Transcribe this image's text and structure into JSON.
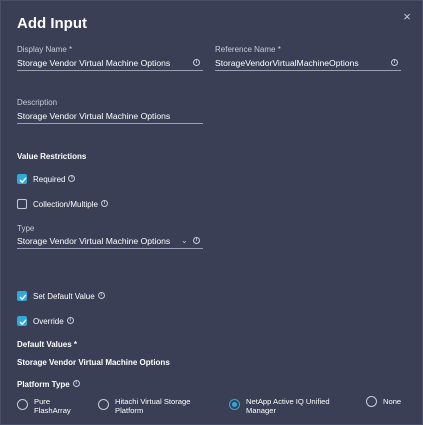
{
  "dialog": {
    "title": "Add Input",
    "close_glyph": "×"
  },
  "display_name": {
    "label": "Display Name *",
    "value": "Storage Vendor Virtual Machine Options"
  },
  "reference_name": {
    "label": "Reference Name *",
    "value": "StorageVendorVirtualMachineOptions"
  },
  "description": {
    "label": "Description",
    "value": "Storage Vendor Virtual Machine Options"
  },
  "value_restrictions": {
    "heading": "Value Restrictions",
    "required_label": "Required",
    "required_checked": true,
    "collection_label": "Collection/Multiple",
    "collection_checked": false
  },
  "type": {
    "label": "Type",
    "value": "Storage Vendor Virtual Machine Options"
  },
  "defaults": {
    "set_default_label": "Set Default Value",
    "set_default_checked": true,
    "override_label": "Override",
    "override_checked": true,
    "heading": "Default Values *",
    "value": "Storage Vendor Virtual Machine Options"
  },
  "platform_type": {
    "label": "Platform Type",
    "options": [
      {
        "line1": "Pure",
        "line2": "FlashArray",
        "selected": false
      },
      {
        "line1": "Hitachi Virtual Storage",
        "line2": "Platform",
        "selected": false
      },
      {
        "line1": "NetApp Active IQ Unified",
        "line2": "Manager",
        "selected": true
      },
      {
        "line1": "None",
        "line2": "",
        "selected": false
      }
    ]
  },
  "icons": {
    "info": "info-icon",
    "check": "check-icon",
    "chevron": "chevron-down-icon",
    "close": "close-icon"
  },
  "colors": {
    "background": "#3a3f56",
    "accent": "#2fa9d8",
    "text": "#ffffff",
    "muted": "#c8ccd8"
  }
}
